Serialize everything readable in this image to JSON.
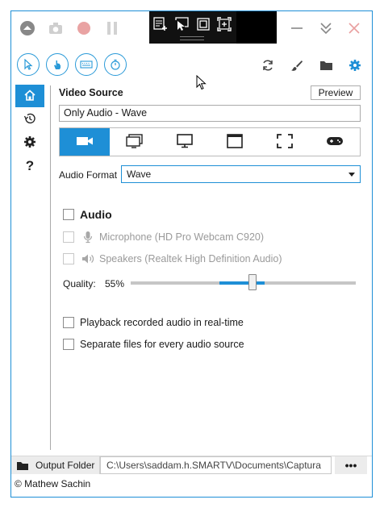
{
  "titlebar": {
    "left_buttons": [
      "up-arrow-icon",
      "camera-icon",
      "record-icon",
      "pause-icon"
    ],
    "overlay_buttons": [
      "region-add-icon",
      "pointer-screen-icon",
      "square-icon",
      "region-expand-icon"
    ],
    "right_buttons": [
      "minimize-icon",
      "collapse-icon",
      "close-icon"
    ]
  },
  "toolbar": {
    "left_tools": [
      "cursor-icon",
      "hand-click-icon",
      "keyboard-icon",
      "timer-icon"
    ],
    "right_tools": [
      "refresh-icon",
      "brush-icon",
      "folder-icon",
      "gear-icon"
    ]
  },
  "sidebar": {
    "items": [
      "home-icon",
      "history-icon",
      "gear-icon",
      "help-icon"
    ],
    "help_glyph": "?"
  },
  "video_source": {
    "title": "Video Source",
    "preview_label": "Preview",
    "value": "Only Audio  -  Wave",
    "tabs": [
      "camera-icon",
      "window-icon",
      "screen-icon",
      "window-frame-icon",
      "fullscreen-icon",
      "gamepad-icon"
    ]
  },
  "audio_format": {
    "label": "Audio Format",
    "value": "Wave"
  },
  "audio": {
    "title": "Audio",
    "microphone_label": "Microphone (HD Pro Webcam C920)",
    "speakers_label": "Speakers (Realtek High Definition Audio)",
    "quality_label": "Quality:",
    "quality_value": "55%",
    "quality_fraction": 0.55
  },
  "options": {
    "playback_label": "Playback recorded audio in real-time",
    "separate_label": "Separate files for every audio source"
  },
  "bottom": {
    "output_folder_label": "Output Folder",
    "path": "C:\\Users\\saddam.h.SMARTV\\Documents\\Captura",
    "more_label": "•••"
  },
  "footer": {
    "copyright": "© Mathew Sachin"
  },
  "colors": {
    "accent": "#1e8fd6",
    "record": "#e57373",
    "close": "#e08a8a"
  }
}
